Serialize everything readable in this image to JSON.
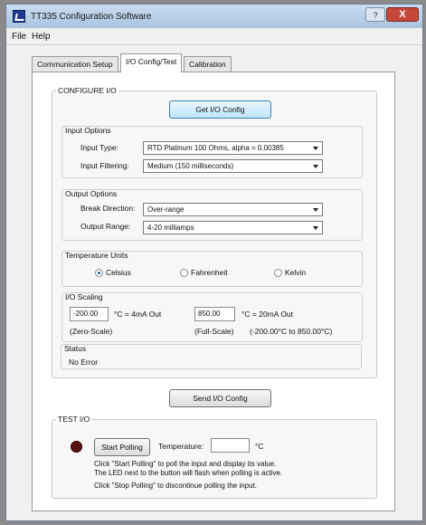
{
  "window": {
    "title": "TT335 Configuration Software",
    "help_glyph": "?",
    "close_glyph": "X"
  },
  "menu": {
    "file": "File",
    "help": "Help"
  },
  "tabs": [
    {
      "label": "Communication Setup"
    },
    {
      "label": "I/O Config/Test"
    },
    {
      "label": "Calibration"
    }
  ],
  "configure": {
    "title": "CONFIGURE I/O",
    "get_button": "Get I/O Config",
    "input_options": {
      "title": "Input Options",
      "type_label": "Input Type:",
      "type_value": "RTD Platinum 100 Ohms, alpha = 0.00385",
      "filter_label": "Input Filtering:",
      "filter_value": "Medium  (150 milliseconds)"
    },
    "output_options": {
      "title": "Output Options",
      "break_label": "Break Direction:",
      "break_value": "Over-range",
      "range_label": "Output Range:",
      "range_value": "4-20 milliamps"
    },
    "units": {
      "title": "Temperature Units",
      "celsius": "Celsius",
      "fahrenheit": "Fahrenheit",
      "kelvin": "Kelvin",
      "selected": "Celsius"
    },
    "scaling": {
      "title": "I/O Scaling",
      "zero_value": "-200.00",
      "zero_unit": "°C = 4mA Out",
      "zero_caption": "(Zero-Scale)",
      "full_value": "850.00",
      "full_unit": "°C = 20mA Out",
      "full_caption": "(Full-Scale)",
      "range_caption": "(-200.00°C to 850.00°C)"
    },
    "status": {
      "title": "Status",
      "value": "No Error"
    },
    "send_button": "Send I/O Config"
  },
  "test": {
    "title": "TEST I/O",
    "start_button": "Start Polling",
    "temp_label": "Temperature:",
    "temp_value": "",
    "temp_unit": "°C",
    "help_line1": "Click \"Start Polling\" to poll the input and display its value.",
    "help_line2": "The LED next to the button will flash when polling is active.",
    "help_line3": "Click \"Stop Polling\" to discontinue polling the input."
  },
  "colors": {
    "led_off": "#5a1010",
    "titlebar": "#b9cfe8",
    "focus_button": "#bee6fd"
  }
}
